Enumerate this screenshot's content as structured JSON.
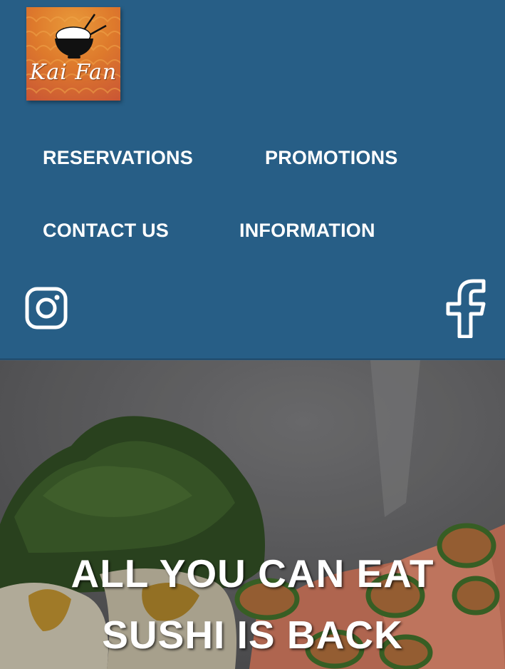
{
  "brand": {
    "logo_text": "Kai Fan",
    "colors": {
      "header_bg": "#275e86",
      "logo_orange": "#de7a2c",
      "logo_red": "#c95535"
    }
  },
  "nav": {
    "items": [
      {
        "label": "RESERVATIONS"
      },
      {
        "label": "PROMOTIONS"
      },
      {
        "label": "CONTACT US"
      },
      {
        "label": "INFORMATION"
      }
    ]
  },
  "social": {
    "icons": [
      "instagram-icon",
      "facebook-icon"
    ]
  },
  "hero": {
    "title_line1": "ALL YOU CAN EAT",
    "title_line2": "SUSHI IS BACK"
  }
}
